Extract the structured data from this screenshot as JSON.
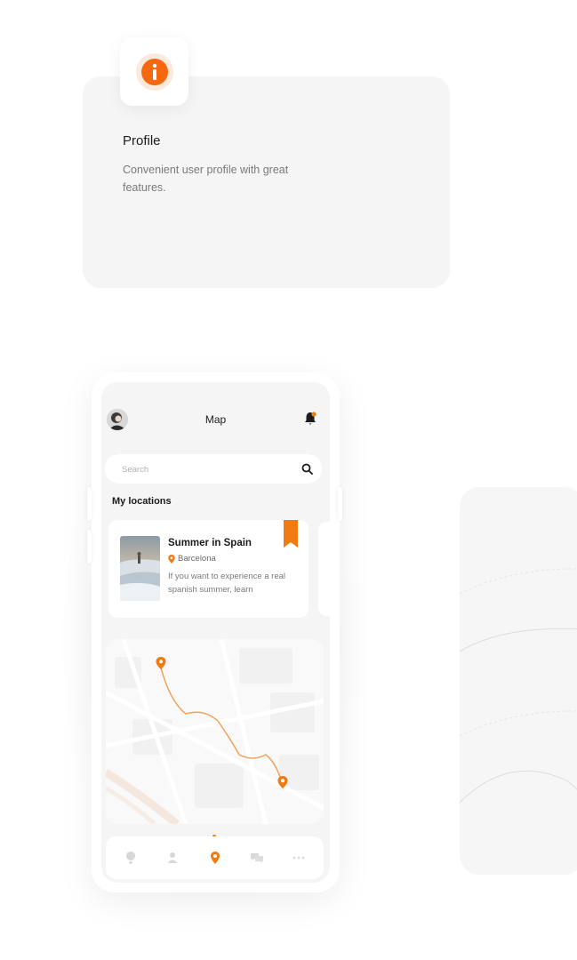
{
  "feature": {
    "title": "Profile",
    "description": "Convenient user profile with great features.",
    "icon": "info-icon",
    "accent_color": "#f5680d"
  },
  "app": {
    "header_title": "Map",
    "search": {
      "placeholder": "Search",
      "value": ""
    },
    "section_title": "My locations",
    "location_card": {
      "title": "Summer in Spain",
      "place": "Barcelona",
      "description": "If you want to experience a real spanish summer, learn"
    },
    "tabs": [
      {
        "icon": "balloon-icon",
        "active": false
      },
      {
        "icon": "user-icon",
        "active": false
      },
      {
        "icon": "location-pin-icon",
        "active": true
      },
      {
        "icon": "chat-icon",
        "active": false
      },
      {
        "icon": "more-icon",
        "active": false
      }
    ],
    "accent_color": "#f07b12"
  }
}
